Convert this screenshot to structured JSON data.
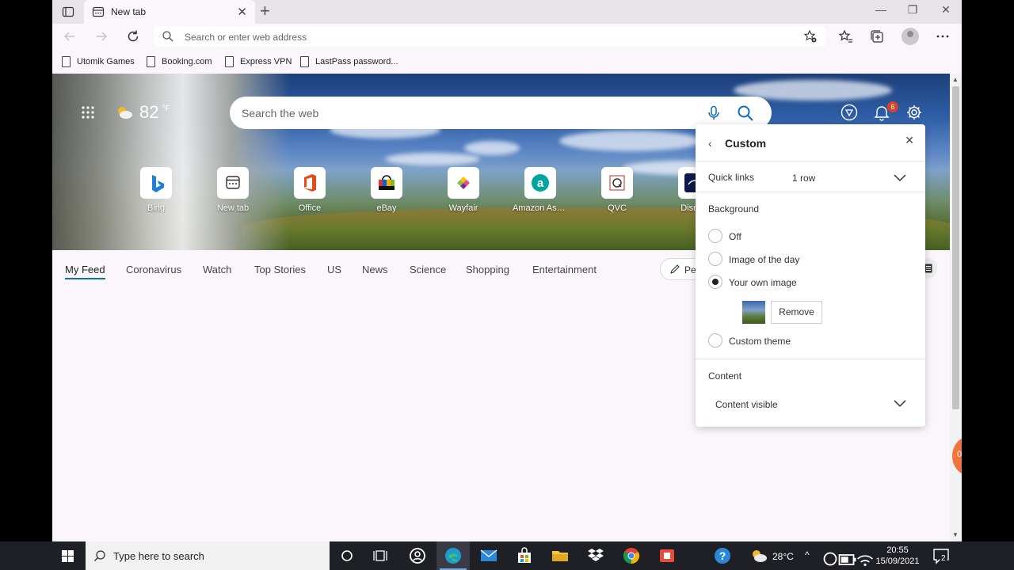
{
  "tabbar": {
    "tab_title": "New tab"
  },
  "toolbar": {
    "address_placeholder": "Search or enter web address"
  },
  "favorites": [
    {
      "label": "Utomik Games"
    },
    {
      "label": "Booking.com"
    },
    {
      "label": "Express VPN"
    },
    {
      "label": "LastPass password..."
    }
  ],
  "hero": {
    "temperature": "82",
    "temp_unit": "°F",
    "search_placeholder": "Search the web",
    "notification_count": "6"
  },
  "quick_links": [
    {
      "label": "Bing"
    },
    {
      "label": "New tab"
    },
    {
      "label": "Office"
    },
    {
      "label": "eBay"
    },
    {
      "label": "Wayfair"
    },
    {
      "label": "Amazon Assi..."
    },
    {
      "label": "QVC"
    },
    {
      "label": "Disney"
    }
  ],
  "feed_tabs": [
    {
      "label": "My Feed"
    },
    {
      "label": "Coronavirus"
    },
    {
      "label": "Watch"
    },
    {
      "label": "Top Stories"
    },
    {
      "label": "US"
    },
    {
      "label": "News"
    },
    {
      "label": "Science"
    },
    {
      "label": "Shopping"
    },
    {
      "label": "Entertainment"
    }
  ],
  "personalize_label": "Pe",
  "side_badge": "0",
  "panel": {
    "title": "Custom",
    "quick_links_label": "Quick links",
    "quick_links_value": "1 row",
    "background_label": "Background",
    "options": [
      {
        "label": "Off"
      },
      {
        "label": "Image of the day"
      },
      {
        "label": "Your own image"
      },
      {
        "label": "Custom theme"
      }
    ],
    "selected_option": "Your own image",
    "remove_label": "Remove",
    "content_label": "Content",
    "content_value": "Content visible"
  },
  "taskbar": {
    "search_placeholder": "Type here to search",
    "weather": "28°C",
    "time": "20:55",
    "date": "15/09/2021",
    "notification_count": "2"
  },
  "colors": {
    "accent": "#0f6cbd",
    "badge": "#d6432b",
    "page_bg": "#fbf6fb",
    "taskbar_bg": "#1f1f26"
  }
}
